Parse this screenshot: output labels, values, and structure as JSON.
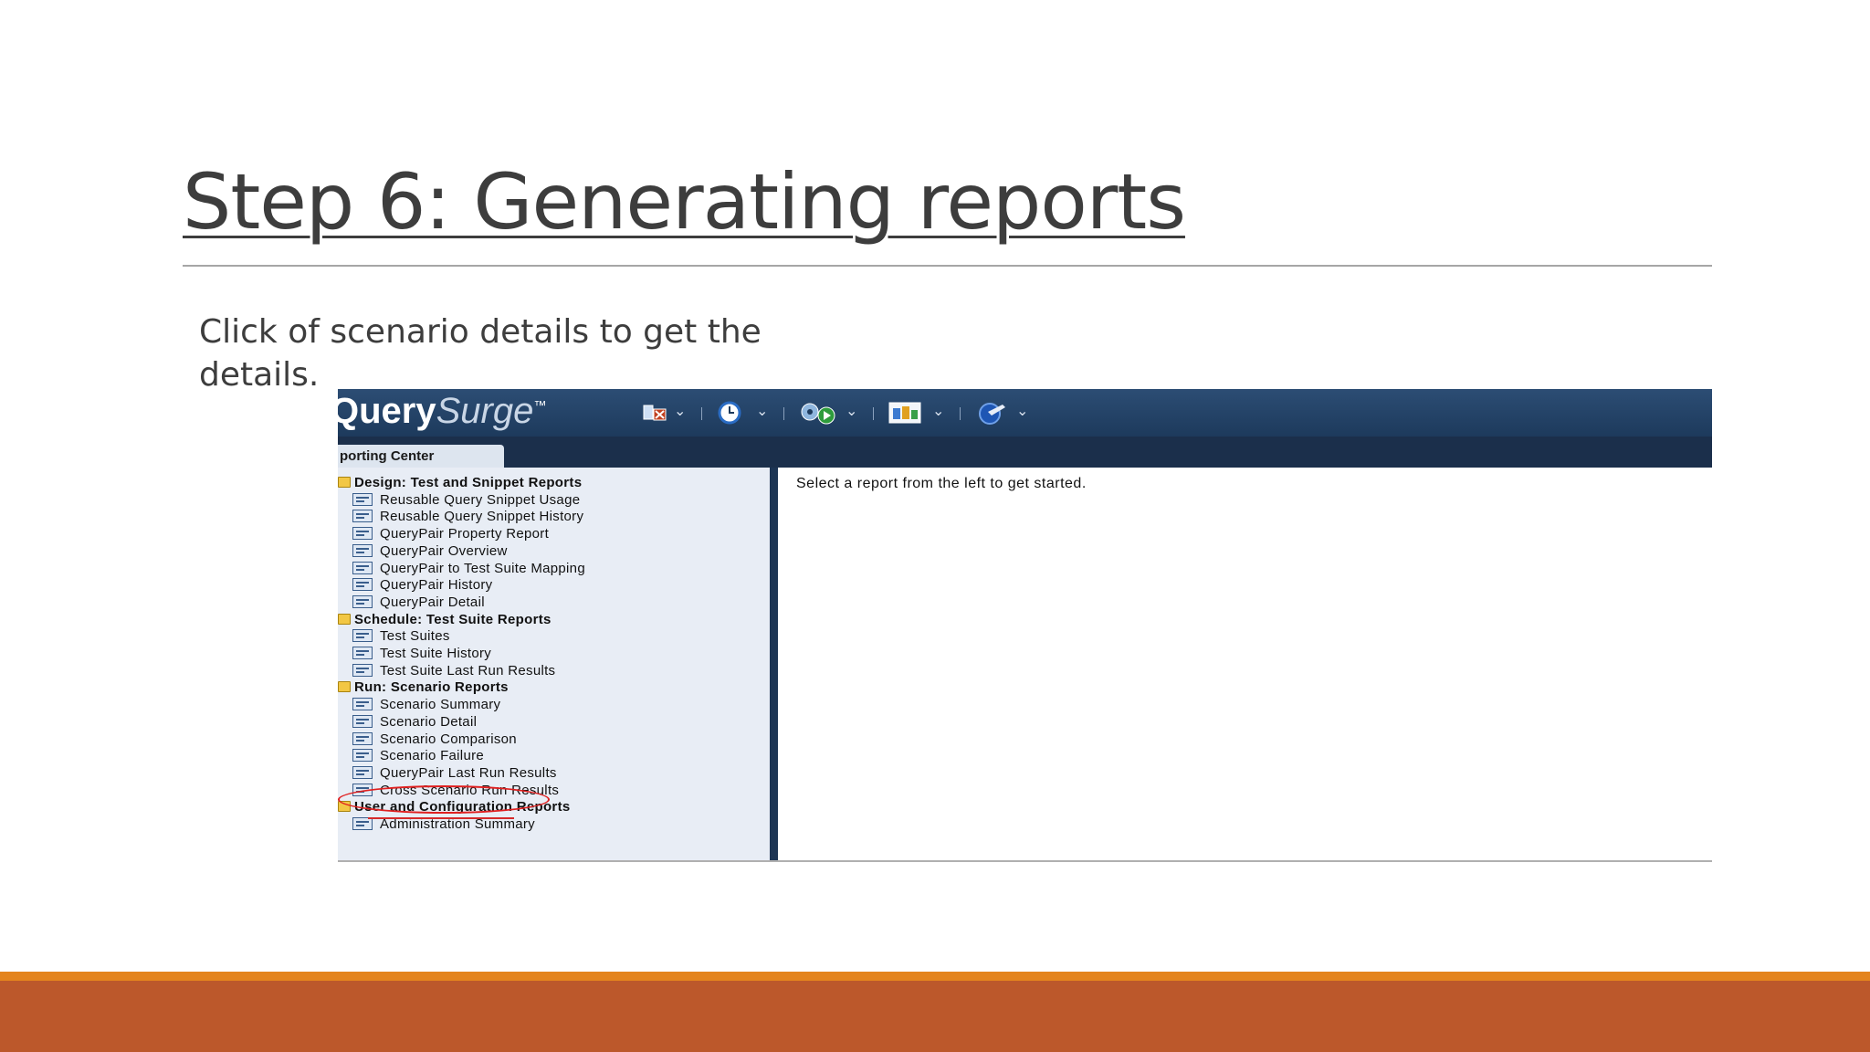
{
  "slide": {
    "title": "Step 6: Generating reports",
    "instruction": "Click of scenario details to get the details."
  },
  "app": {
    "brand_bold": "Query",
    "brand_light": "Surge",
    "brand_mark": "™",
    "tab": "porting Center",
    "welcome_text": "Select a report from the left to get started.",
    "toolbar_icons": [
      "design-icon",
      "clock-icon",
      "run-gear-icon",
      "reports-icon",
      "admin-icon"
    ]
  },
  "tree": {
    "categories": [
      {
        "label": "Design: Test and Snippet Reports",
        "items": [
          "Reusable Query Snippet Usage",
          "Reusable Query Snippet History",
          "QueryPair Property Report",
          "QueryPair Overview",
          "QueryPair to Test Suite Mapping",
          "QueryPair History",
          "QueryPair Detail"
        ]
      },
      {
        "label": "Schedule: Test Suite Reports",
        "items": [
          "Test Suites",
          "Test Suite History",
          "Test Suite Last Run Results"
        ]
      },
      {
        "label": "Run: Scenario Reports",
        "items": [
          "Scenario Summary",
          "Scenario Detail",
          "Scenario Comparison",
          "Scenario Failure",
          "QueryPair Last Run Results",
          "Cross Scenario Run Results"
        ]
      },
      {
        "label": "User and Configuration Reports",
        "items": [
          "Administration Summary"
        ]
      }
    ]
  },
  "colors": {
    "title_text": "#3d3d3d",
    "toolbar": "#2c4d74",
    "annotation": "#e02020",
    "footer": "#bc582b",
    "footer_stripe": "#e4841d"
  }
}
